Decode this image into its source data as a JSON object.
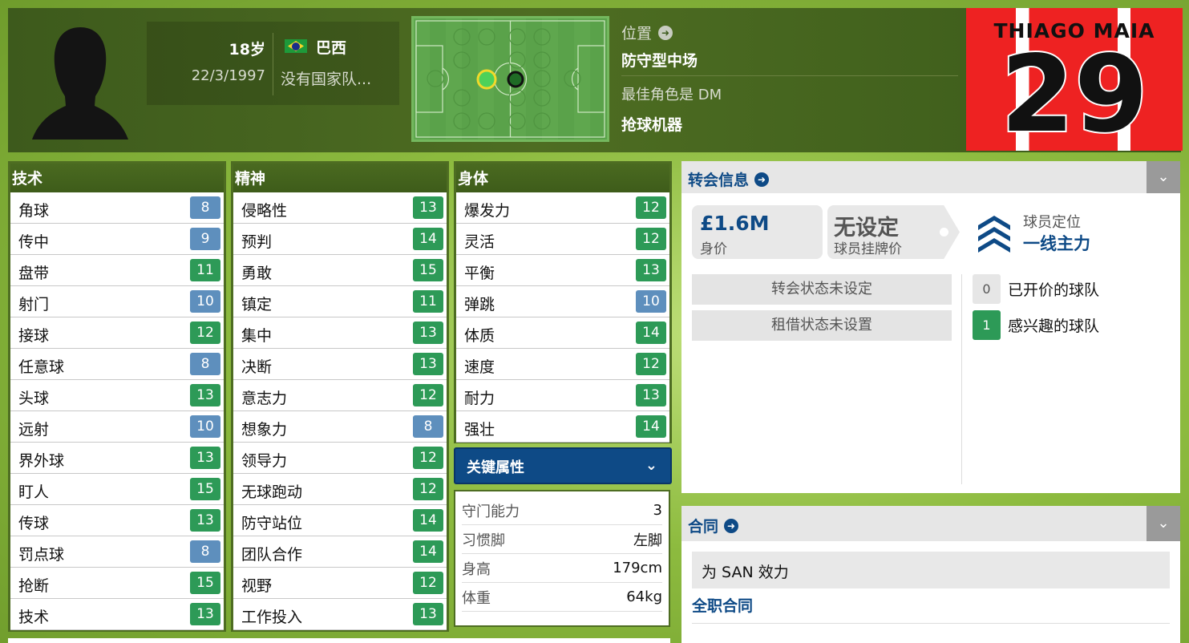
{
  "header": {
    "age": "18岁",
    "dob": "22/3/1997",
    "nation": "巴西",
    "national_team": "没有国家队...",
    "position_title": "位置",
    "position_value": "防守型中场",
    "best_role": "最佳角色是 DM",
    "role": "抢球机器",
    "shirt_name": "THIAGO MAIA",
    "shirt_number": "29"
  },
  "technical": {
    "title": "技术",
    "rows": [
      {
        "name": "角球",
        "value": "8",
        "color": "blue"
      },
      {
        "name": "传中",
        "value": "9",
        "color": "blue"
      },
      {
        "name": "盘带",
        "value": "11",
        "color": "green"
      },
      {
        "name": "射门",
        "value": "10",
        "color": "blue"
      },
      {
        "name": "接球",
        "value": "12",
        "color": "green"
      },
      {
        "name": "任意球",
        "value": "8",
        "color": "blue"
      },
      {
        "name": "头球",
        "value": "13",
        "color": "green"
      },
      {
        "name": "远射",
        "value": "10",
        "color": "blue"
      },
      {
        "name": "界外球",
        "value": "13",
        "color": "green"
      },
      {
        "name": "盯人",
        "value": "15",
        "color": "green"
      },
      {
        "name": "传球",
        "value": "13",
        "color": "green"
      },
      {
        "name": "罚点球",
        "value": "8",
        "color": "blue"
      },
      {
        "name": "抢断",
        "value": "15",
        "color": "green"
      },
      {
        "name": "技术",
        "value": "13",
        "color": "green"
      }
    ]
  },
  "mental": {
    "title": "精神",
    "rows": [
      {
        "name": "侵略性",
        "value": "13",
        "color": "green"
      },
      {
        "name": "预判",
        "value": "14",
        "color": "green"
      },
      {
        "name": "勇敢",
        "value": "15",
        "color": "green"
      },
      {
        "name": "镇定",
        "value": "11",
        "color": "green"
      },
      {
        "name": "集中",
        "value": "13",
        "color": "green"
      },
      {
        "name": "决断",
        "value": "13",
        "color": "green"
      },
      {
        "name": "意志力",
        "value": "12",
        "color": "green"
      },
      {
        "name": "想象力",
        "value": "8",
        "color": "blue"
      },
      {
        "name": "领导力",
        "value": "12",
        "color": "green"
      },
      {
        "name": "无球跑动",
        "value": "12",
        "color": "green"
      },
      {
        "name": "防守站位",
        "value": "14",
        "color": "green"
      },
      {
        "name": "团队合作",
        "value": "14",
        "color": "green"
      },
      {
        "name": "视野",
        "value": "12",
        "color": "green"
      },
      {
        "name": "工作投入",
        "value": "13",
        "color": "green"
      }
    ]
  },
  "physical": {
    "title": "身体",
    "rows": [
      {
        "name": "爆发力",
        "value": "12",
        "color": "green"
      },
      {
        "name": "灵活",
        "value": "12",
        "color": "green"
      },
      {
        "name": "平衡",
        "value": "13",
        "color": "green"
      },
      {
        "name": "弹跳",
        "value": "10",
        "color": "blue"
      },
      {
        "name": "体质",
        "value": "14",
        "color": "green"
      },
      {
        "name": "速度",
        "value": "12",
        "color": "green"
      },
      {
        "name": "耐力",
        "value": "13",
        "color": "green"
      },
      {
        "name": "强壮",
        "value": "14",
        "color": "green"
      }
    ]
  },
  "key_attributes": {
    "title": "关键属性",
    "rows": [
      {
        "k": "守门能力",
        "v": "3"
      },
      {
        "k": "习惯脚",
        "v": "左脚"
      },
      {
        "k": "身高",
        "v": "179cm"
      },
      {
        "k": "体重",
        "v": "64kg"
      }
    ]
  },
  "transfer": {
    "title": "转会信息",
    "value_amount": "£1.6M",
    "value_label": "身价",
    "asking_value": "无设定",
    "asking_label": "球员挂牌价",
    "status_label": "球员定位",
    "status_value": "一线主力",
    "transfer_status": "转会状态未设定",
    "loan_status": "租借状态未设置",
    "bids_count": "0",
    "bids_label": "已开价的球队",
    "interest_count": "1",
    "interest_label": "感兴趣的球队"
  },
  "contract": {
    "title": "合同",
    "playing_for": "为 SAN 效力",
    "type": "全职合同"
  },
  "colors": {
    "badge_blue": "#5e8fbd",
    "badge_green": "#2d9a57",
    "accent_blue": "#0e4a86",
    "header_green": "#4e6d22"
  }
}
